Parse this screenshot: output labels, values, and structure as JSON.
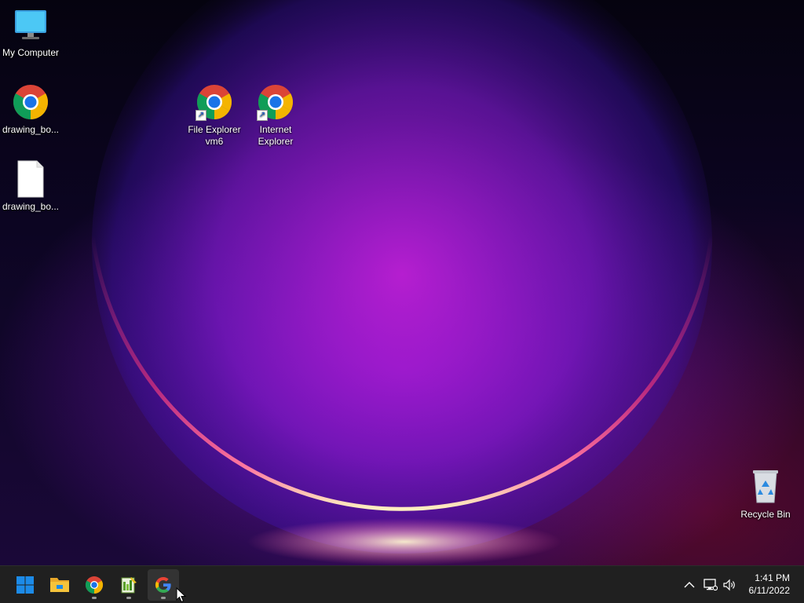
{
  "desktop": {
    "icons": {
      "my_computer": "My Computer",
      "drawing_chrome": "drawing_bo...",
      "drawing_file": "drawing_bo...",
      "file_explorer_line1": "File Explorer",
      "file_explorer_line2": "vm6",
      "internet_explorer_line1": "Internet",
      "internet_explorer_line2": "Explorer",
      "recycle_bin": "Recycle Bin"
    }
  },
  "taskbar": {
    "apps": [
      "start-icon",
      "file-explorer-icon",
      "chrome-icon",
      "notepad-plus-icon",
      "google-icon"
    ],
    "clock": {
      "time": "1:41 PM",
      "date": "6/11/2022"
    },
    "tray": [
      "chevron-up-icon",
      "network-icon",
      "volume-icon"
    ]
  },
  "colors": {
    "taskbar_bg": "#202020",
    "accent_blue": "#1c8be8",
    "folder_yellow": "#f5c33b"
  }
}
